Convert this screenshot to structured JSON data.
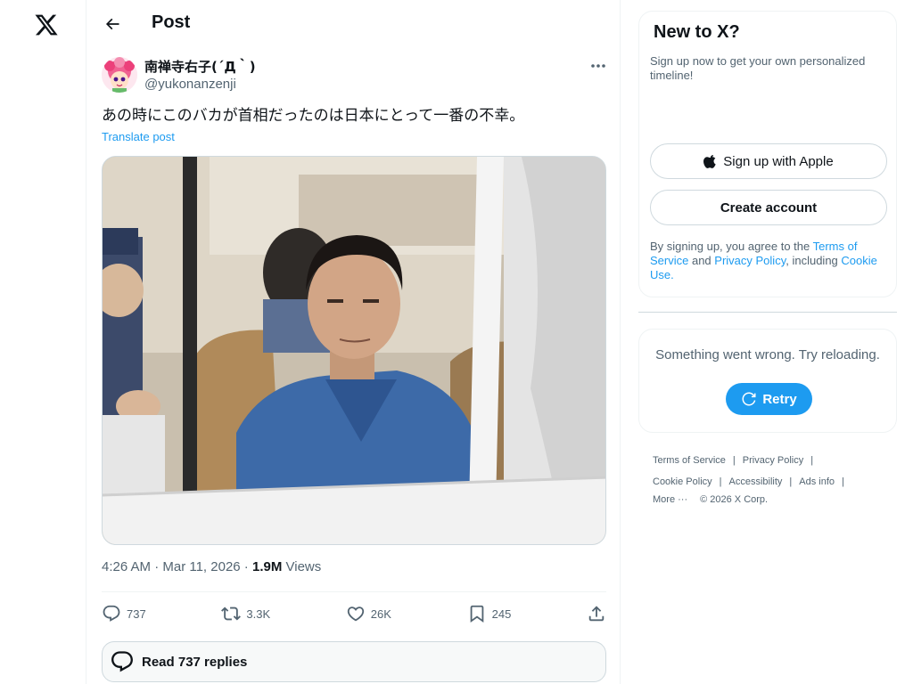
{
  "header": {
    "title": "Post"
  },
  "post": {
    "display_name": "南禅寺右子(´Д｀)",
    "handle": "@yukonanzenji",
    "text": "あの時にこのバカが首相だったのは日本にとって一番の不幸。",
    "translate_label": "Translate post",
    "time": "4:26 AM · Mar 11, 2026 · ",
    "views_count": "1.9M",
    "views_label": " Views",
    "stats": {
      "replies": "737",
      "reposts": "3.3K",
      "likes": "26K",
      "bookmarks": "245"
    },
    "read_replies_label": "Read 737 replies"
  },
  "sidebar": {
    "signup_title": "New to X?",
    "signup_subtitle": "Sign up now to get your own personalized timeline!",
    "apple_button": "Sign up with Apple",
    "create_button": "Create account",
    "terms_prefix": "By signing up, you agree to the ",
    "terms_link": "Terms of Service",
    "terms_and": " and ",
    "privacy_link": "Privacy Policy",
    "terms_including": ", including ",
    "cookie_link": "Cookie Use.",
    "error_text": "Something went wrong. Try reloading.",
    "retry_label": "Retry"
  },
  "footer": {
    "terms": "Terms of Service",
    "privacy": "Privacy Policy",
    "cookie": "Cookie Policy",
    "accessibility": "Accessibility",
    "ads": "Ads info",
    "more": "More ···",
    "copyright": "© 2026 X Corp."
  },
  "colors": {
    "accent": "#1d9bf0",
    "text_primary": "#0f1419",
    "text_secondary": "#536471",
    "border": "#cfd9de"
  }
}
